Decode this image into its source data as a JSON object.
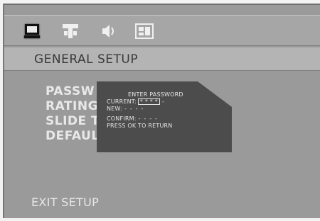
{
  "tabs": [
    {
      "name": "general",
      "icon": "monitor-icon"
    },
    {
      "name": "audio",
      "icon": "speaker-setup-icon"
    },
    {
      "name": "audio-volume",
      "icon": "sound-icon"
    },
    {
      "name": "preference",
      "icon": "preference-icon"
    }
  ],
  "title": "GENERAL SETUP",
  "menu": {
    "items": [
      "PASSW",
      "RATING",
      "SLIDE T",
      "DEFAUL"
    ]
  },
  "exit_label": "EXIT SETUP",
  "dialog": {
    "header": "ENTER PASSWORD",
    "current_label": "CURRENT:",
    "current_value": "* * * *",
    "current_trail": "-",
    "new_label": "NEW:",
    "new_value": "- - - -",
    "confirm_label": "CONFIRM:",
    "confirm_value": "- - - -",
    "hint": "PRESS OK TO RETURN"
  },
  "colors": {
    "screen_bg": "#9a9a9a",
    "dialog_bg": "#4c4c4c",
    "text_light": "#e8e8e8",
    "title_text": "#3a3a3a"
  }
}
